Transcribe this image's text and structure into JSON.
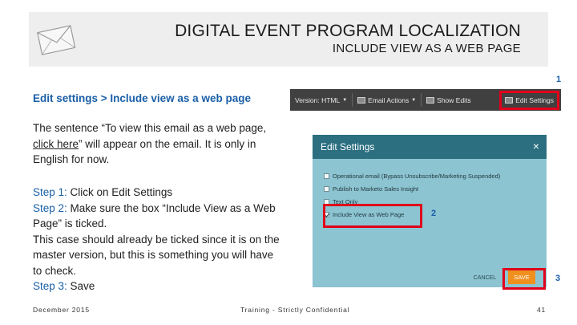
{
  "header": {
    "title": "DIGITAL EVENT PROGRAM LOCALIZATION",
    "subtitle": "INCLUDE VIEW AS A WEB PAGE",
    "icon": "envelope-icon"
  },
  "left": {
    "edit_path": "Edit settings > Include view as a web page",
    "sentence_before": "The sentence “To view this email as a web page, ",
    "sentence_link": "click here",
    "sentence_after": "” will appear on the email. It is only in English for now.",
    "step1_label": "Step 1:",
    "step1_text": " Click on Edit Settings",
    "step2_label": "Step 2:",
    "step2_text": " Make sure the box “Include View as a Web Page” is ticked.",
    "note": "This case should already be ticked since it is on the master version, but this is something you will have to check.",
    "step3_label": "Step 3:",
    "step3_text": " Save"
  },
  "toolbar": {
    "version": "Version: HTML",
    "email_actions": "Email Actions",
    "show_edits": "Show Edits",
    "edit_settings": "Edit Settings"
  },
  "markers": {
    "one": "1",
    "two": "2",
    "three": "3"
  },
  "dialog": {
    "title": "Edit Settings",
    "close": "×",
    "options": [
      {
        "label": "Operational email (Bypass Unsubscribe/Marketing Suspended)",
        "checked": false
      },
      {
        "label": "Publish to Marketo Sales Insight",
        "checked": false
      },
      {
        "label": "Text Only",
        "checked": false
      },
      {
        "label": "Include View as Web Page",
        "checked": true
      }
    ],
    "cancel": "CANCEL",
    "save": "SAVE"
  },
  "footer": {
    "date": "December 2015",
    "center": "Training - Strictly Confidential",
    "page": "41"
  },
  "colors": {
    "accent_blue": "#1a5fa8",
    "highlight_red": "#e0001b",
    "dialog_header": "#2b6f80",
    "dialog_body": "#8cc4d1",
    "save_orange": "#f0901e",
    "toolbar": "#404040"
  }
}
